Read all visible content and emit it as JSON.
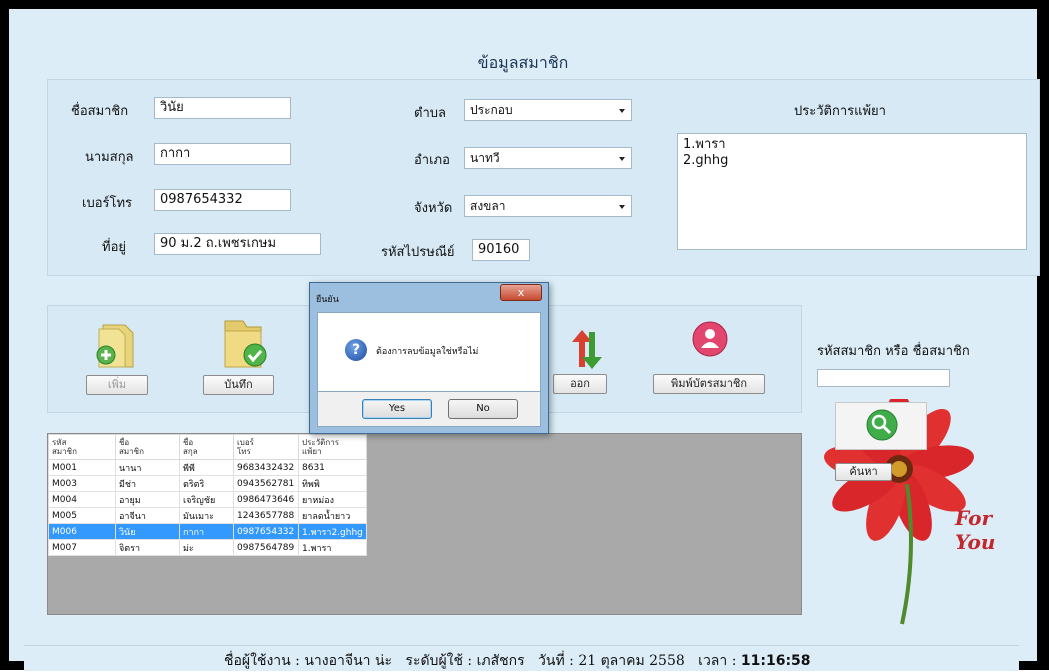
{
  "form_title": "ข้อมูลสมาชิก",
  "fields": {
    "first_name": {
      "label": "ชื่อสมาชิก",
      "value": "วินัย"
    },
    "last_name": {
      "label": "นามสกุล",
      "value": "กากา"
    },
    "phone": {
      "label": "เบอร์โทร",
      "value": "0987654332"
    },
    "address": {
      "label": "ที่อยู่",
      "value": "90 ม.2 ถ.เพชรเกษม"
    },
    "subdistrict": {
      "label": "ตำบล",
      "value": "ประกอบ"
    },
    "district": {
      "label": "อำเภอ",
      "value": "นาทวี"
    },
    "province": {
      "label": "จังหวัด",
      "value": "สงขลา"
    },
    "postal_code": {
      "label": "รหัสไปรษณีย์",
      "value": "90160"
    },
    "allergy_history": {
      "label": "ประวัติการแพ้ยา",
      "value": "1.พารา\n2.ghhg"
    }
  },
  "toolbar": {
    "add": "เพิ่ม",
    "save": "บันทึก",
    "exit": "ออก",
    "print_card": "พิมพ์บัตรสมาชิก"
  },
  "search": {
    "label": "รหัสสมาชิก หรือ ชื่อสมาชิก",
    "value": "",
    "button": "ค้นหา"
  },
  "promo_text": "For You",
  "table": {
    "headers": [
      "รหัส\nสมาชิก",
      "ชื่อ\nสมาชิก",
      "ชื่อ\nสกุล",
      "เบอร์\nโทร",
      "ประวัติการ\nแพ้ยา"
    ],
    "rows": [
      [
        "M001",
        "นานา",
        "พีพี",
        "9683432432",
        "8631"
      ],
      [
        "M003",
        "มีช่า",
        "ตริตริ",
        "0943562781",
        "ทิพพิ"
      ],
      [
        "M004",
        "อายุม",
        "เจริญชัย",
        "0986473646",
        "ยาหม่อง"
      ],
      [
        "M005",
        "อาจีนา",
        "มันเมาะ",
        "1243657788",
        "ยาลดน้ำยาว"
      ],
      [
        "M006",
        "วินัย",
        "กากา",
        "0987654332",
        "1.พารา2.ghhg"
      ],
      [
        "M007",
        "จิตรา",
        "ม่ะ",
        "0987564789",
        "1.พารา"
      ]
    ],
    "selected_row": "M006"
  },
  "status_bar": {
    "user_label": "ชื่อผู้ใช้งาน :",
    "user_value": "นางอาจีนา  น่ะ",
    "level_label": "ระดับผู้ใช้ :",
    "level_value": "เภสัชกร",
    "date_label": "วันที่ :",
    "date_value": "21 ตุลาคม 2558",
    "time_label": "เวลา :",
    "time_value": "11:16:58"
  },
  "dialog": {
    "title": "ยืนยัน",
    "close": "x",
    "message": "ต้องการลบข้อมูลใช่หรือไม่",
    "yes": "Yes",
    "no": "No"
  },
  "colors": {
    "form_bg": "#dcedf7",
    "selected_row": "#3399ff",
    "grid_bg": "#a9a9a9"
  }
}
